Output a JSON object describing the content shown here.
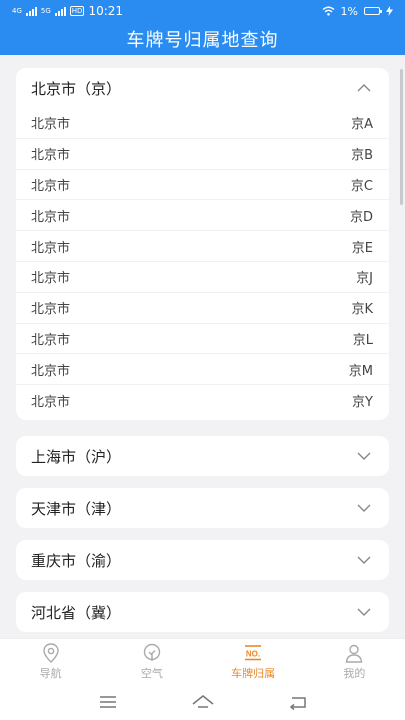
{
  "status_bar": {
    "network_left": "4G",
    "network_right": "5G",
    "hd": "HD",
    "time": "10:21",
    "battery": "1%"
  },
  "header": {
    "title": "车牌号归属地查询"
  },
  "sections": [
    {
      "title": "北京市（京）",
      "expanded": true,
      "rows": [
        {
          "city": "北京市",
          "code": "京A"
        },
        {
          "city": "北京市",
          "code": "京B"
        },
        {
          "city": "北京市",
          "code": "京C"
        },
        {
          "city": "北京市",
          "code": "京D"
        },
        {
          "city": "北京市",
          "code": "京E"
        },
        {
          "city": "北京市",
          "code": "京J"
        },
        {
          "city": "北京市",
          "code": "京K"
        },
        {
          "city": "北京市",
          "code": "京L"
        },
        {
          "city": "北京市",
          "code": "京M"
        },
        {
          "city": "北京市",
          "code": "京Y"
        }
      ]
    },
    {
      "title": "上海市（沪）",
      "expanded": false
    },
    {
      "title": "天津市（津）",
      "expanded": false
    },
    {
      "title": "重庆市（渝）",
      "expanded": false
    },
    {
      "title": "河北省（冀）",
      "expanded": false
    }
  ],
  "tabbar": {
    "tabs": [
      {
        "label": "导航",
        "icon": "location-pin-icon",
        "active": false
      },
      {
        "label": "空气",
        "icon": "leaf-icon",
        "active": false
      },
      {
        "label": "车牌归属",
        "icon": "license-plate-icon",
        "active": true,
        "icon_text": "NO."
      },
      {
        "label": "我的",
        "icon": "person-icon",
        "active": false
      }
    ],
    "active_color": "#e8892a",
    "inactive_color": "#aaaaaa"
  },
  "colors": {
    "primary": "#2a8cf0",
    "background": "#f2f2f4"
  }
}
